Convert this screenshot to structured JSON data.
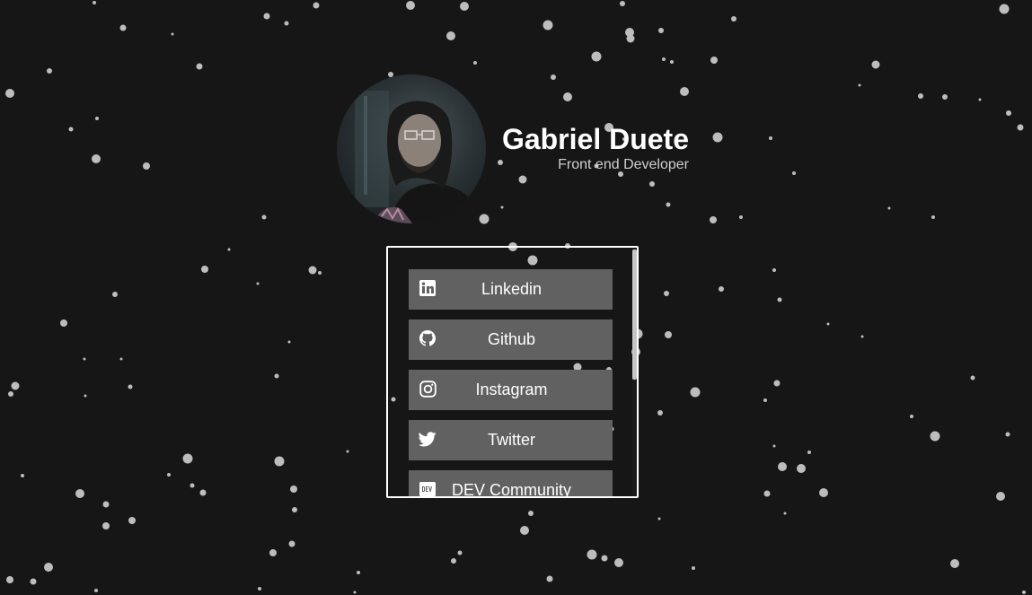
{
  "profile": {
    "name": "Gabriel Duete",
    "role": "Front end Developer"
  },
  "links": [
    {
      "label": "Linkedin",
      "icon": "linkedin-icon"
    },
    {
      "label": "Github",
      "icon": "github-icon"
    },
    {
      "label": "Instagram",
      "icon": "instagram-icon"
    },
    {
      "label": "Twitter",
      "icon": "twitter-icon"
    },
    {
      "label": "DEV Community",
      "icon": "dev-community-icon"
    }
  ],
  "colors": {
    "background": "#161616",
    "button": "#616161",
    "text": "#ffffff",
    "subtext": "#cfcfcf",
    "star": "#bdbdbd"
  }
}
